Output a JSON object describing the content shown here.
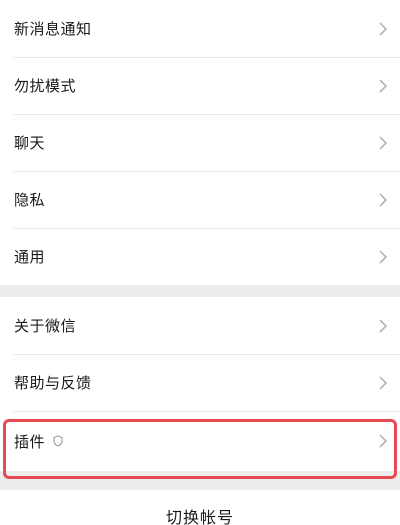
{
  "settings": {
    "group1": [
      {
        "label": "新消息通知"
      },
      {
        "label": "勿扰模式"
      },
      {
        "label": "聊天"
      },
      {
        "label": "隐私"
      },
      {
        "label": "通用"
      }
    ],
    "group2": [
      {
        "label": "关于微信"
      },
      {
        "label": "帮助与反馈"
      },
      {
        "label": "插件"
      }
    ]
  },
  "footer": {
    "switch_account_label": "切换帐号"
  },
  "colors": {
    "highlight_border": "#e84a55",
    "background": "#ededed",
    "row_background": "#ffffff"
  },
  "icons": {
    "row_arrow": "chevron-right-icon",
    "plugin_badge": "shield-icon"
  }
}
